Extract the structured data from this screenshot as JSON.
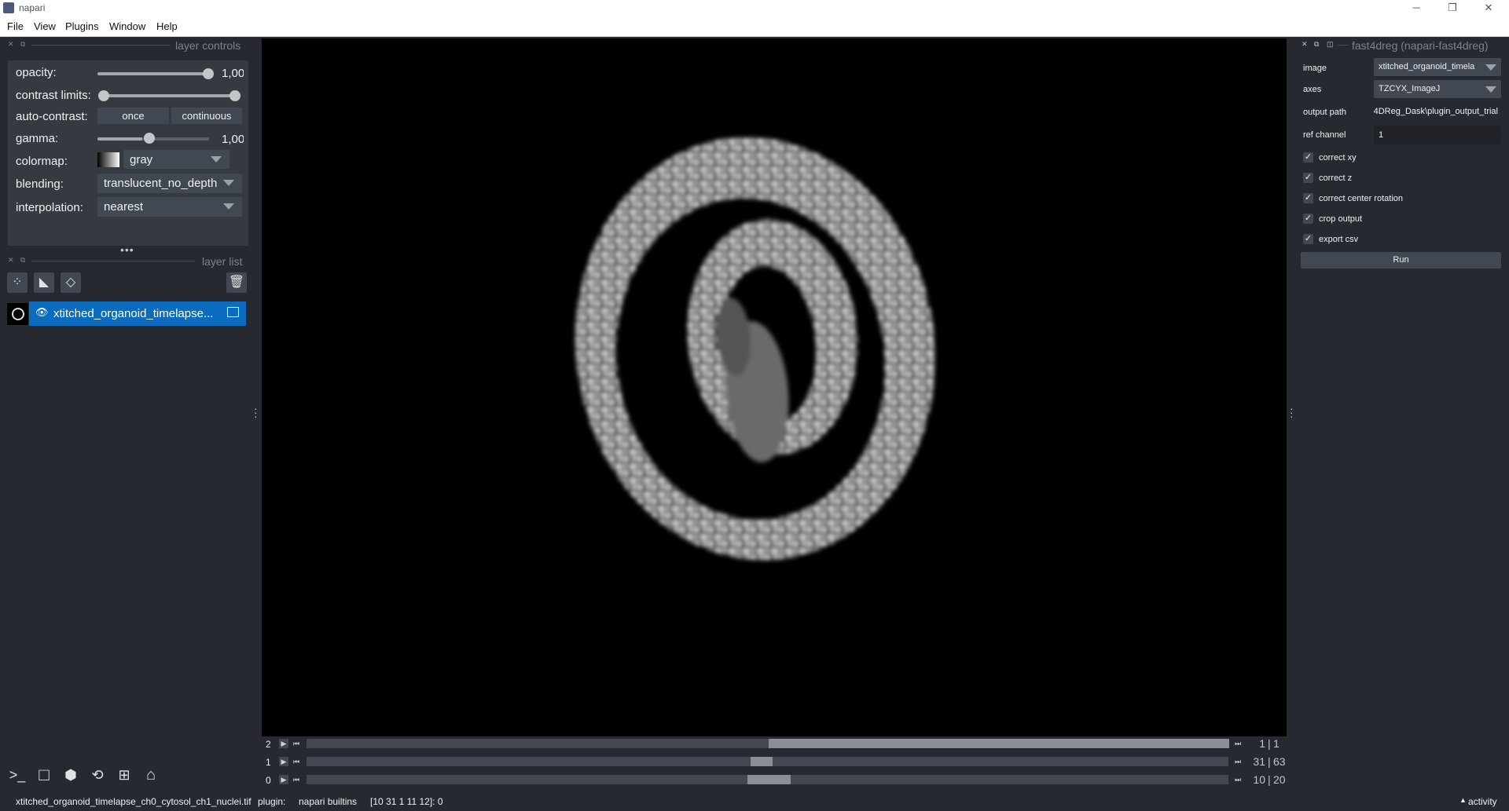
{
  "window": {
    "title": "napari",
    "minimize": "─",
    "maximize": "❐",
    "close": "✕"
  },
  "menu": [
    "File",
    "View",
    "Plugins",
    "Window",
    "Help"
  ],
  "layer_controls": {
    "header": "layer controls",
    "opacity": {
      "label": "opacity:",
      "value": "1,00",
      "level": 1.0
    },
    "contrast_limits": {
      "label": "contrast limits:"
    },
    "auto_contrast": {
      "label": "auto-contrast:",
      "once": "once",
      "continuous": "continuous"
    },
    "gamma": {
      "label": "gamma:",
      "value": "1,00"
    },
    "colormap": {
      "label": "colormap:",
      "value": "gray"
    },
    "blending": {
      "label": "blending:",
      "value": "translucent_no_depth"
    },
    "interpolation": {
      "label": "interpolation:",
      "value": "nearest"
    }
  },
  "layer_list": {
    "header": "layer list",
    "tools": [
      "points-icon",
      "shapes-icon",
      "labels-icon",
      "trash-icon"
    ],
    "layers": [
      {
        "name": "xtitched_organoid_timelapse...",
        "visible": true,
        "selected": true
      }
    ]
  },
  "bottom_toolbar": [
    "console-icon",
    "square-icon",
    "cube-icon",
    "rotate-icon",
    "grid-icon",
    "home-icon"
  ],
  "dims": [
    {
      "index": "2",
      "current": "1",
      "max": "1",
      "fraction": 0.5
    },
    {
      "index": "1",
      "current": "31",
      "max": "63",
      "fraction": 0.492
    },
    {
      "index": "0",
      "current": "10",
      "max": "20",
      "fraction": 0.5
    }
  ],
  "plugin": {
    "title": "fast4dreg (napari-fast4dreg)",
    "image": {
      "label": "image",
      "value": "xtitched_organoid_timela"
    },
    "axes": {
      "label": "axes",
      "value": "TZCYX_ImageJ"
    },
    "output_path": {
      "label": "output path",
      "value": "4DReg_Dask\\plugin_output_trial"
    },
    "ref_channel": {
      "label": "ref channel",
      "value": "1"
    },
    "checks": [
      {
        "label": "correct xy",
        "checked": true
      },
      {
        "label": "correct z",
        "checked": true
      },
      {
        "label": "correct center rotation",
        "checked": true
      },
      {
        "label": "crop output",
        "checked": true
      },
      {
        "label": "export csv",
        "checked": true
      }
    ],
    "run": "Run"
  },
  "status": {
    "file": "xtitched_organoid_timelapse_ch0_cytosol_ch1_nuclei.tif",
    "plugin_label": "plugin:",
    "plugin_value": "napari builtins",
    "coords": "[10 31 1 11 12]: 0",
    "activity": "activity"
  }
}
